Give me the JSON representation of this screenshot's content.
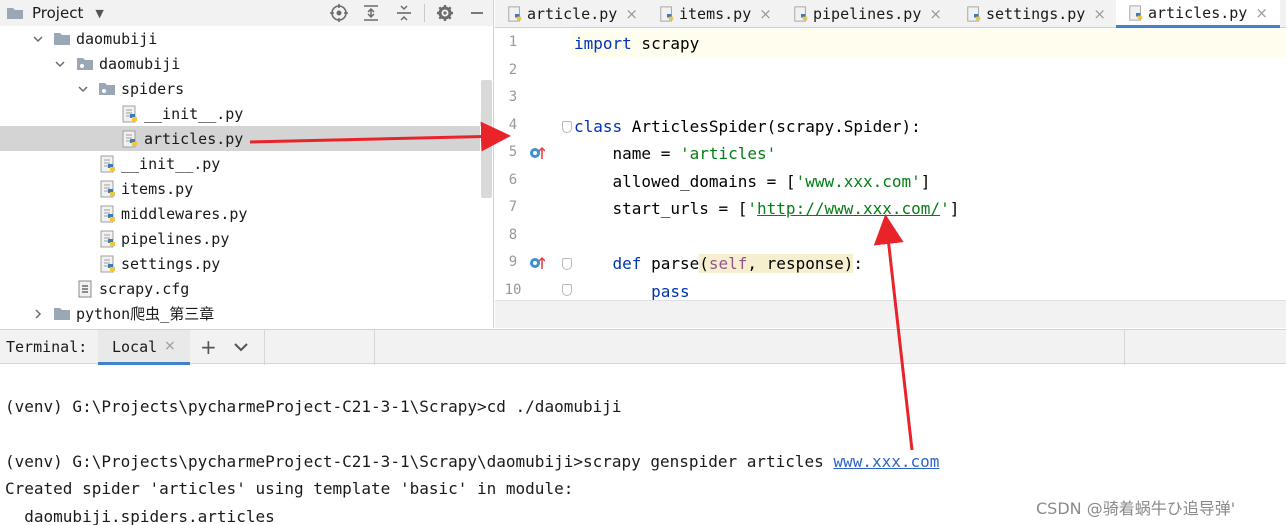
{
  "project_panel": {
    "title": "Project",
    "tree": [
      {
        "label": "daomubiji",
        "type": "folder",
        "expanded": true
      },
      {
        "label": "daomubiji",
        "type": "package",
        "expanded": true
      },
      {
        "label": "spiders",
        "type": "package",
        "expanded": true
      },
      {
        "label": "__init__.py",
        "type": "python"
      },
      {
        "label": "articles.py",
        "type": "python",
        "selected": true
      },
      {
        "label": "__init__.py",
        "type": "python"
      },
      {
        "label": "items.py",
        "type": "python"
      },
      {
        "label": "middlewares.py",
        "type": "python"
      },
      {
        "label": "pipelines.py",
        "type": "python"
      },
      {
        "label": "settings.py",
        "type": "python"
      },
      {
        "label": "scrapy.cfg",
        "type": "config"
      },
      {
        "label": "python爬虫_第三章",
        "type": "folder",
        "expanded": false
      }
    ]
  },
  "editor": {
    "tabs": [
      {
        "label": "article.py",
        "active": false
      },
      {
        "label": "items.py",
        "active": false
      },
      {
        "label": "pipelines.py",
        "active": false
      },
      {
        "label": "settings.py",
        "active": false
      },
      {
        "label": "articles.py",
        "active": true
      }
    ],
    "line_numbers": [
      "1",
      "2",
      "3",
      "4",
      "5",
      "6",
      "7",
      "8",
      "9",
      "10"
    ],
    "code": {
      "l1_kw": "import",
      "l1_rest": " scrapy",
      "l4_kw": "class",
      "l4_rest": " ArticlesSpider(scrapy.Spider):",
      "l5_pre": "    name = ",
      "l5_str": "'articles'",
      "l6_pre": "    allowed_domains = [",
      "l6_str": "'www.xxx.com'",
      "l6_post": "]",
      "l7_pre": "    start_urls = [",
      "l7_q1": "'",
      "l7_url": "http://www.xxx.com/",
      "l7_q2": "'",
      "l7_post": "]",
      "l9_pre": "    ",
      "l9_kw": "def",
      "l9_name": " parse",
      "l9_open": "(",
      "l9_self": "self",
      "l9_args": ", response)",
      "l9_colon": ":",
      "l10_pre": "        ",
      "l10_kw": "pass"
    }
  },
  "terminal": {
    "label": "Terminal:",
    "tab_label": "Local",
    "add_label": "+",
    "lines": {
      "cmd1": "(venv) G:\\Projects\\pycharmeProject-C21-3-1\\Scrapy>cd ./daomubiji",
      "cmd2_prefix": "(venv) G:\\Projects\\pycharmeProject-C21-3-1\\Scrapy\\daomubiji>scrapy genspider articles ",
      "cmd2_link": "www.xxx.com",
      "out1": "Created spider 'articles' using template 'basic' in module:",
      "out2": "  daomubiji.spiders.articles"
    }
  },
  "watermark": "CSDN @骑着蜗牛ひ追导弹'",
  "colors": {
    "accent": "#4083c9",
    "keyword": "#0033b3",
    "string": "#067d17",
    "self": "#94558d",
    "annotation_arrow": "#e8242a"
  }
}
